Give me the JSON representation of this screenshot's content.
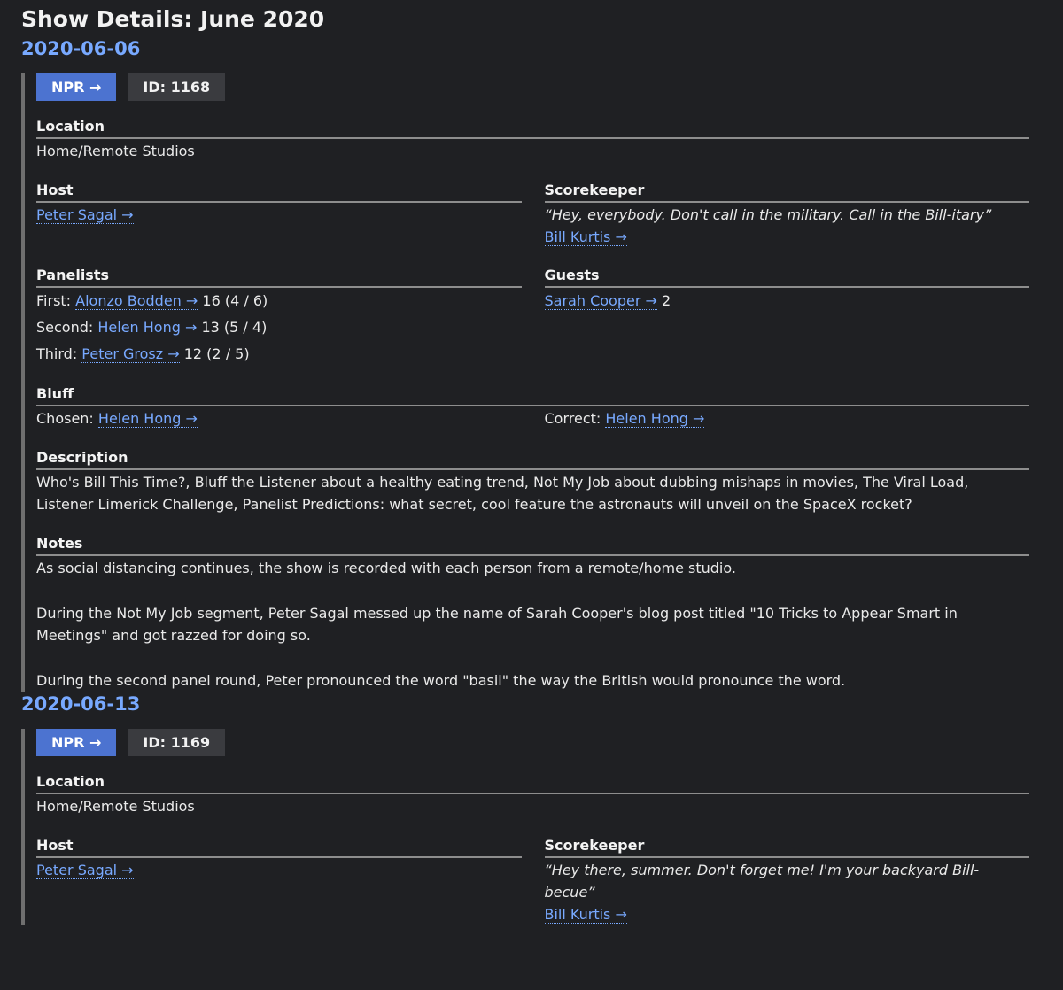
{
  "page": {
    "title": "Show Details: June 2020"
  },
  "labels": {
    "location": "Location",
    "host": "Host",
    "scorekeeper": "Scorekeeper",
    "panelists": "Panelists",
    "guests": "Guests",
    "bluff": "Bluff",
    "description": "Description",
    "notes": "Notes",
    "chosen": "Chosen:",
    "correct": "Correct:",
    "first": "First:",
    "second": "Second:",
    "third": "Third:"
  },
  "shows": [
    {
      "date": "2020-06-06",
      "npr_label": "NPR →",
      "id_label": "ID: 1168",
      "location": "Home/Remote Studios",
      "host": "Peter Sagal →",
      "scorekeeper_quote": "“Hey, everybody. Don't call in the military. Call in the Bill-itary”",
      "scorekeeper": "Bill Kurtis →",
      "panelists": [
        {
          "name": "Alonzo Bodden →",
          "score": "16 (4 / 6)"
        },
        {
          "name": "Helen Hong →",
          "score": "13 (5 / 4)"
        },
        {
          "name": "Peter Grosz →",
          "score": "12 (2 / 5)"
        }
      ],
      "guest": {
        "name": "Sarah Cooper →",
        "score": "2"
      },
      "bluff": {
        "chosen": "Helen Hong →",
        "correct": "Helen Hong →"
      },
      "description": "Who's Bill This Time?, Bluff the Listener about a healthy eating trend, Not My Job about dubbing mishaps in movies, The Viral Load, Listener Limerick Challenge, Panelist Predictions: what secret, cool feature the astronauts will unveil on the SpaceX rocket?",
      "notes": [
        "As social distancing continues, the show is recorded with each person from a remote/home studio.",
        "During the Not My Job segment, Peter Sagal messed up the name of Sarah Cooper's blog post titled \"10 Tricks to Appear Smart in Meetings\" and got razzed for doing so.",
        "During the second panel round, Peter pronounced the word \"basil\" the way the British would pronounce the word."
      ]
    },
    {
      "date": "2020-06-13",
      "npr_label": "NPR →",
      "id_label": "ID: 1169",
      "location": "Home/Remote Studios",
      "host": "Peter Sagal →",
      "scorekeeper_quote": "“Hey there, summer. Don't forget me! I'm your backyard Bill-becue”",
      "scorekeeper": "Bill Kurtis →"
    }
  ]
}
